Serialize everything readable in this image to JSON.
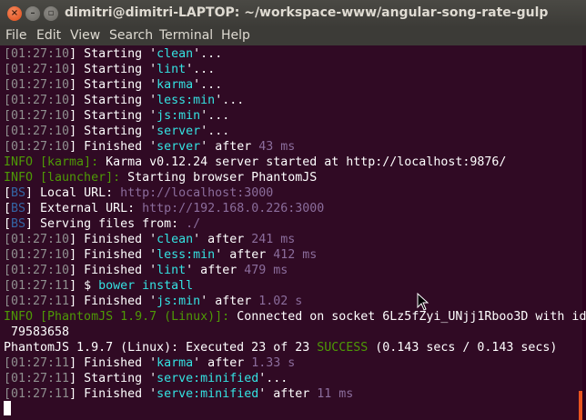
{
  "window": {
    "title": "dimitri@dimitri-LAPTOP: ~/workspace-www/angular-song-rate-gulp"
  },
  "menu": [
    "File",
    "Edit",
    "View",
    "Search",
    "Terminal",
    "Help"
  ],
  "lines": [
    [
      [
        "[",
        "g"
      ],
      [
        "01:27:10",
        "g"
      ],
      [
        "] Starting '",
        "w"
      ],
      [
        "clean",
        "c"
      ],
      [
        "'...",
        "w"
      ]
    ],
    [
      [
        "[",
        "g"
      ],
      [
        "01:27:10",
        "g"
      ],
      [
        "] Starting '",
        "w"
      ],
      [
        "lint",
        "c"
      ],
      [
        "'...",
        "w"
      ]
    ],
    [
      [
        "[",
        "g"
      ],
      [
        "01:27:10",
        "g"
      ],
      [
        "] Starting '",
        "w"
      ],
      [
        "karma",
        "c"
      ],
      [
        "'...",
        "w"
      ]
    ],
    [
      [
        "[",
        "g"
      ],
      [
        "01:27:10",
        "g"
      ],
      [
        "] Starting '",
        "w"
      ],
      [
        "less:min",
        "c"
      ],
      [
        "'...",
        "w"
      ]
    ],
    [
      [
        "[",
        "g"
      ],
      [
        "01:27:10",
        "g"
      ],
      [
        "] Starting '",
        "w"
      ],
      [
        "js:min",
        "c"
      ],
      [
        "'...",
        "w"
      ]
    ],
    [
      [
        "[",
        "g"
      ],
      [
        "01:27:10",
        "g"
      ],
      [
        "] Starting '",
        "w"
      ],
      [
        "server",
        "c"
      ],
      [
        "'...",
        "w"
      ]
    ],
    [
      [
        "[",
        "g"
      ],
      [
        "01:27:10",
        "g"
      ],
      [
        "] Finished '",
        "w"
      ],
      [
        "server",
        "c"
      ],
      [
        "' after ",
        "w"
      ],
      [
        "43 ms",
        "p"
      ]
    ],
    [
      [
        "INFO [karma]: ",
        "gr"
      ],
      [
        "Karma v0.12.24 server started at http://localhost:9876/",
        "w"
      ]
    ],
    [
      [
        "INFO [launcher]: ",
        "gr"
      ],
      [
        "Starting browser PhantomJS",
        "w"
      ]
    ],
    [
      [
        "[",
        "w"
      ],
      [
        "BS",
        "b"
      ],
      [
        "] Local URL: ",
        "w"
      ],
      [
        "http://localhost:3000",
        "p"
      ]
    ],
    [
      [
        "[",
        "w"
      ],
      [
        "BS",
        "b"
      ],
      [
        "] External URL: ",
        "w"
      ],
      [
        "http://192.168.0.226:3000",
        "p"
      ]
    ],
    [
      [
        "[",
        "w"
      ],
      [
        "BS",
        "b"
      ],
      [
        "] Serving files from: ",
        "w"
      ],
      [
        "./",
        "p"
      ]
    ],
    [
      [
        "[",
        "g"
      ],
      [
        "01:27:10",
        "g"
      ],
      [
        "] Finished '",
        "w"
      ],
      [
        "clean",
        "c"
      ],
      [
        "' after ",
        "w"
      ],
      [
        "241 ms",
        "p"
      ]
    ],
    [
      [
        "[",
        "g"
      ],
      [
        "01:27:10",
        "g"
      ],
      [
        "] Finished '",
        "w"
      ],
      [
        "less:min",
        "c"
      ],
      [
        "' after ",
        "w"
      ],
      [
        "412 ms",
        "p"
      ]
    ],
    [
      [
        "[",
        "g"
      ],
      [
        "01:27:10",
        "g"
      ],
      [
        "] Finished '",
        "w"
      ],
      [
        "lint",
        "c"
      ],
      [
        "' after ",
        "w"
      ],
      [
        "479 ms",
        "p"
      ]
    ],
    [
      [
        "[",
        "g"
      ],
      [
        "01:27:11",
        "g"
      ],
      [
        "] $ ",
        "w"
      ],
      [
        "bower install",
        "c"
      ]
    ],
    [
      [
        "[",
        "g"
      ],
      [
        "01:27:11",
        "g"
      ],
      [
        "] Finished '",
        "w"
      ],
      [
        "js:min",
        "c"
      ],
      [
        "' after ",
        "w"
      ],
      [
        "1.02 s",
        "p"
      ]
    ],
    [
      [
        "INFO [PhantomJS 1.9.7 (Linux)]: ",
        "gr"
      ],
      [
        "Connected on socket 6Lz5fZyi_UNjj1Rboo3D with id",
        "w"
      ]
    ],
    [
      [
        " 79583658",
        "w"
      ]
    ],
    [
      [
        "PhantomJS 1.9.7 (Linux): Executed 23 of 23 ",
        "w"
      ],
      [
        "SUCCESS",
        "gr"
      ],
      [
        " (0.143 secs / 0.143 secs)",
        "w"
      ]
    ],
    [
      [
        "[",
        "g"
      ],
      [
        "01:27:11",
        "g"
      ],
      [
        "] Finished '",
        "w"
      ],
      [
        "karma",
        "c"
      ],
      [
        "' after ",
        "w"
      ],
      [
        "1.33 s",
        "p"
      ]
    ],
    [
      [
        "[",
        "g"
      ],
      [
        "01:27:11",
        "g"
      ],
      [
        "] Starting '",
        "w"
      ],
      [
        "serve:minified",
        "c"
      ],
      [
        "'...",
        "w"
      ]
    ],
    [
      [
        "[",
        "g"
      ],
      [
        "01:27:11",
        "g"
      ],
      [
        "] Finished '",
        "w"
      ],
      [
        "serve:minified",
        "c"
      ],
      [
        "' after ",
        "w"
      ],
      [
        "11 ms",
        "p"
      ]
    ]
  ]
}
